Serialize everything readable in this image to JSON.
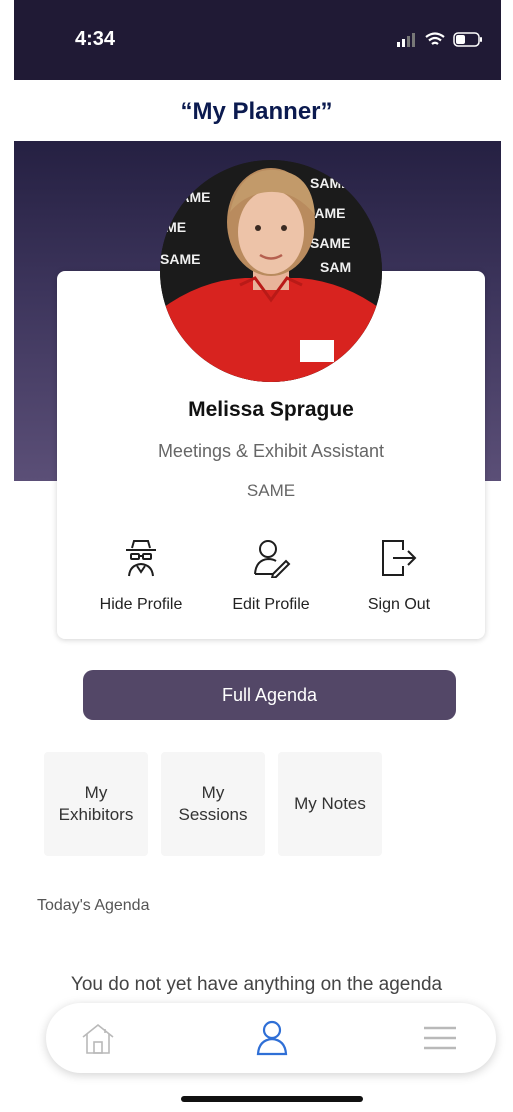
{
  "status_bar": {
    "time": "4:34"
  },
  "caption": "“My Planner”",
  "profile": {
    "name": "Melissa Sprague",
    "role": "Meetings & Exhibit Assistant",
    "organization": "SAME",
    "avatar_icon": "profile-photo"
  },
  "actions": [
    {
      "label": "Hide Profile",
      "icon": "incognito-icon"
    },
    {
      "label": "Edit Profile",
      "icon": "edit-user-icon"
    },
    {
      "label": "Sign Out",
      "icon": "sign-out-icon"
    }
  ],
  "full_agenda_label": "Full Agenda",
  "tiles": [
    {
      "line1": "My",
      "line2": "Exhibitors"
    },
    {
      "line1": "My",
      "line2": "Sessions"
    },
    {
      "line1": "My Notes",
      "line2": ""
    }
  ],
  "todays_agenda": {
    "title": "Today's Agenda",
    "empty_message": "You do not yet have anything on the agenda"
  },
  "tab_bar": {
    "items": [
      {
        "icon": "home-icon"
      },
      {
        "icon": "profile-icon",
        "active": true
      },
      {
        "icon": "menu-icon"
      }
    ],
    "active_color": "#2f6fd6",
    "inactive_color": "#b9b9b9"
  },
  "colors": {
    "status_bar": "#201a35",
    "hero_top": "#252042",
    "hero_bottom": "#5b4f77",
    "button": "#534767",
    "caption": "#0b1a4f"
  }
}
